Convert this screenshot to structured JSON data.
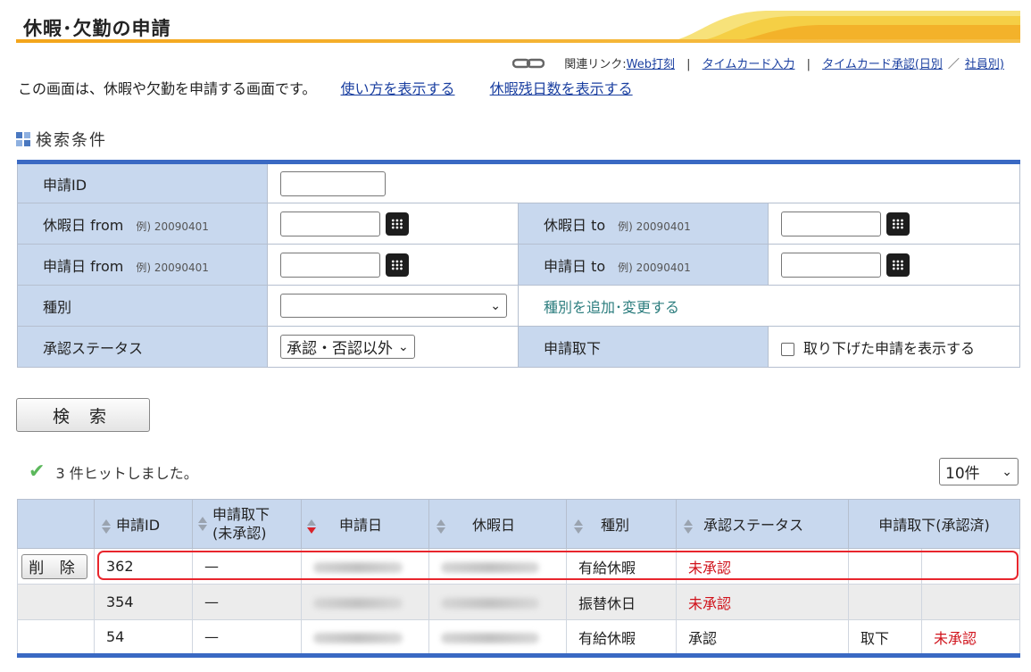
{
  "page": {
    "title": "休暇･欠勤の申請",
    "intro_text": "この画面は、休暇や欠勤を申請する画面です。",
    "intro_links": [
      "使い方を表示する",
      "休暇残日数を表示する"
    ]
  },
  "related_links": {
    "label": "関連リンク:",
    "links": [
      "Web打刻",
      "タイムカード入力",
      "タイムカード承認(日別",
      "社員別)"
    ],
    "separator": "|",
    "slash": "／"
  },
  "search": {
    "section_title": "検索条件",
    "fields": {
      "request_id": "申請ID",
      "leave_from": "休暇日 from",
      "leave_to": "休暇日 to",
      "apply_from": "申請日 from",
      "apply_to": "申請日 to",
      "example": "例) 20090401",
      "type": "種別",
      "type_link": "種別を追加･変更する",
      "status": "承認ステータス",
      "status_value": "承認・否認以外",
      "withdraw": "申請取下",
      "withdraw_checkbox": "取り下げた申請を表示する"
    },
    "button": "検 索"
  },
  "results": {
    "hit_text": "3 件ヒットしました。",
    "page_size": "10件",
    "headers": {
      "id": "申請ID",
      "withdraw_unapproved": "申請取下\n(未承認)",
      "apply_date": "申請日",
      "leave_date": "休暇日",
      "type": "種別",
      "status": "承認ステータス",
      "withdraw_approved": "申請取下(承認済)"
    },
    "delete_button": "削 除",
    "rows": [
      {
        "id": "362",
        "withdraw": "—",
        "type": "有給休暇",
        "status": "未承認",
        "w1": "",
        "w2": ""
      },
      {
        "id": "354",
        "withdraw": "—",
        "type": "振替休日",
        "status": "未承認",
        "w1": "",
        "w2": ""
      },
      {
        "id": "54",
        "withdraw": "—",
        "type": "有給休暇",
        "status": "承認",
        "w1": "取下",
        "w2": "未承認"
      }
    ]
  },
  "colors": {
    "accent": "#3a69c3",
    "label_bg": "#c8d8ee",
    "title_orange": "#f3a51b",
    "red": "#d0121b"
  }
}
